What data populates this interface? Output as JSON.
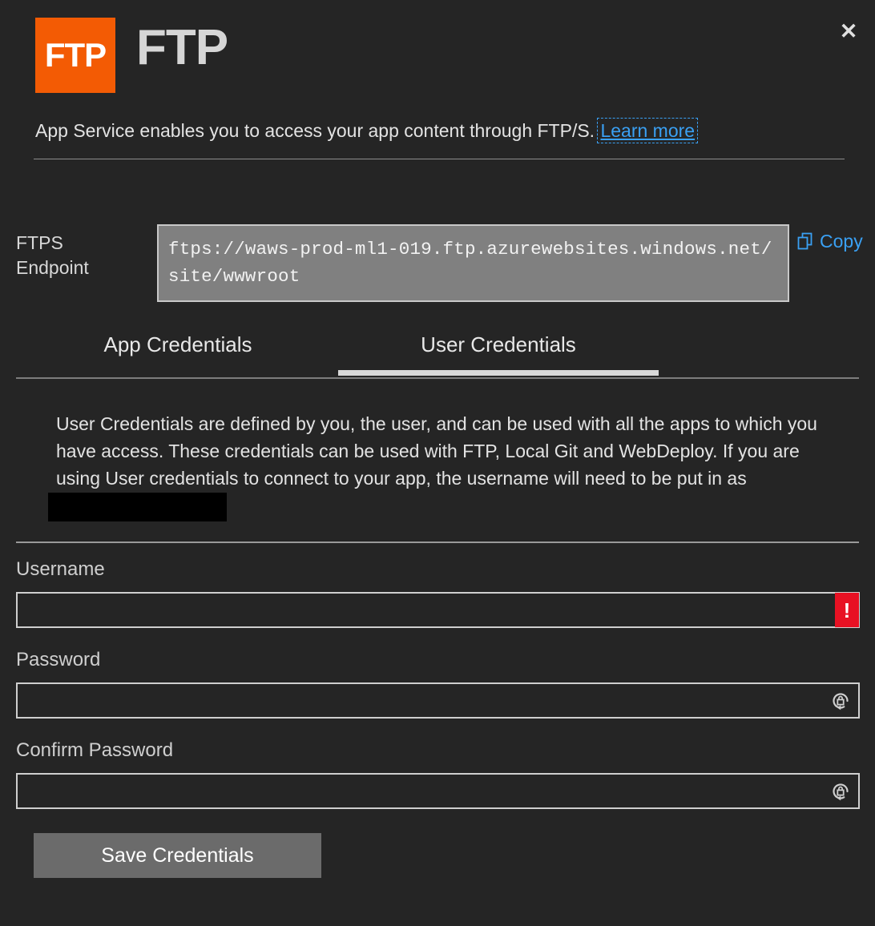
{
  "window": {
    "title": "FTP",
    "logo_text": "FTP",
    "close_label": "✕"
  },
  "description": {
    "text": "App Service enables you to access your app content through FTP/S.",
    "link_label": "Learn more"
  },
  "endpoint": {
    "label_line1": "FTPS",
    "label_line2": "Endpoint",
    "value": "ftps://waws-prod-ml1-019.ftp.azurewebsites.windows.net/site/wwwroot",
    "copy_label": "Copy"
  },
  "tabs": [
    {
      "id": "app-credentials",
      "label": "App Credentials",
      "active": false
    },
    {
      "id": "user-credentials",
      "label": "User Credentials",
      "active": true
    }
  ],
  "panel": {
    "paragraph": "User Credentials are defined by you, the user, and can be used with all the apps to which you have access. These credentials can be used with FTP, Local Git and WebDeploy. If you are using User credentials to connect to your app, the username will need to be put in as"
  },
  "form": {
    "username": {
      "label": "Username",
      "value": "",
      "placeholder": "",
      "error": true,
      "error_glyph": "!"
    },
    "password": {
      "label": "Password",
      "value": "",
      "placeholder": ""
    },
    "confirm_password": {
      "label": "Confirm Password",
      "value": "",
      "placeholder": ""
    },
    "save_label": "Save Credentials"
  },
  "colors": {
    "background": "#252525",
    "logo_orange": "#f35b04",
    "link_blue": "#3aa0f3",
    "error_red": "#e81123",
    "button_gray": "#6b6b6b",
    "endpoint_gray": "#808080"
  }
}
